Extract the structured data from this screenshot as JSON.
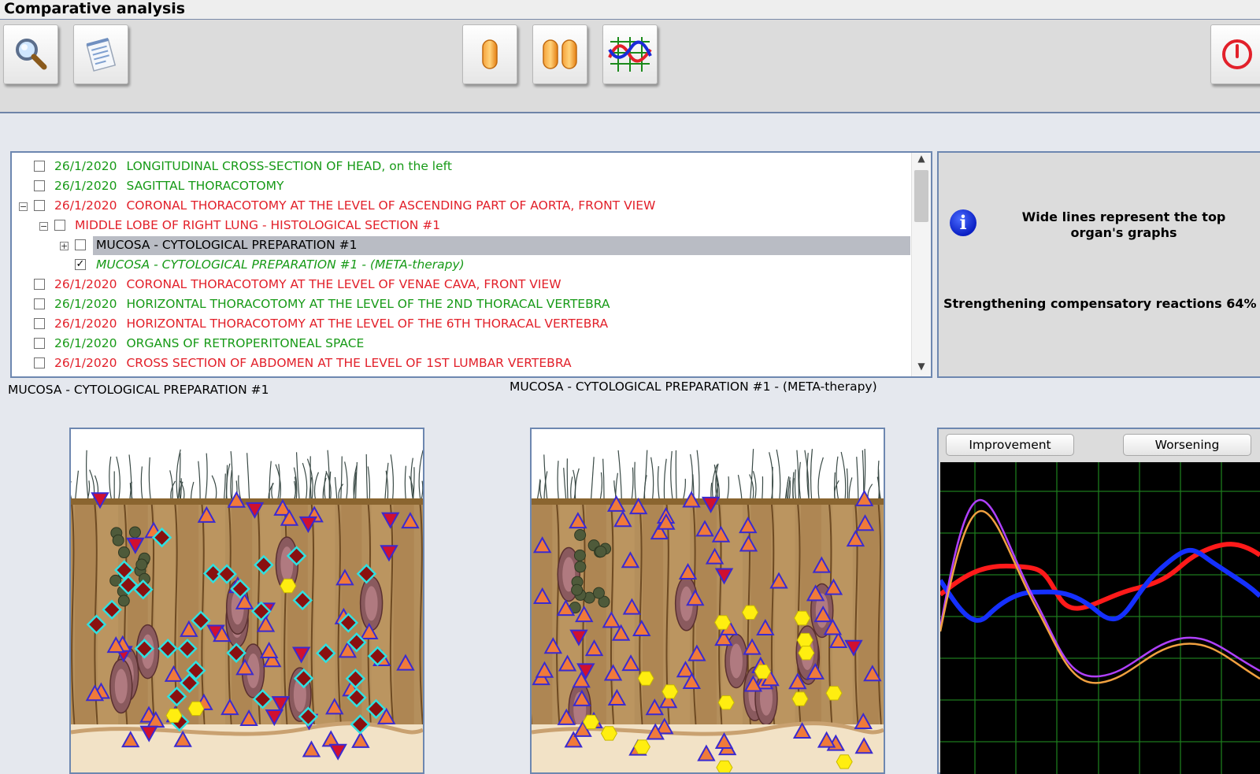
{
  "window": {
    "title": "Comparative analysis"
  },
  "toolbar": {
    "buttons": [
      {
        "name": "search-button",
        "icon": "magnifier-icon"
      },
      {
        "name": "notes-button",
        "icon": "notepad-icon"
      },
      {
        "name": "single-view-button",
        "icon": "single-capsule-icon"
      },
      {
        "name": "double-view-button",
        "icon": "double-capsule-icon"
      },
      {
        "name": "graph-view-button",
        "icon": "graph-icon"
      },
      {
        "name": "power-button",
        "icon": "power-icon"
      }
    ]
  },
  "tree": {
    "rows": [
      {
        "date": "26/1/2020",
        "label": "LONGITUDINAL CROSS-SECTION OF HEAD, on the left",
        "color": "green",
        "checked": false
      },
      {
        "date": "26/1/2020",
        "label": "SAGITTAL THORACOTOMY",
        "color": "green",
        "checked": false
      },
      {
        "date": "26/1/2020",
        "label": "CORONAL THORACOTOMY AT THE LEVEL OF ASCENDING PART OF AORTA, FRONT VIEW",
        "color": "red",
        "checked": false,
        "expander": "−"
      },
      {
        "date": "",
        "label": "MIDDLE LOBE OF RIGHT LUNG - HISTOLOGICAL SECTION #1",
        "color": "red",
        "checked": false,
        "expander": "−"
      },
      {
        "date": "",
        "label": "MUCOSA - CYTOLOGICAL PREPARATION #1",
        "color": "black",
        "checked": false,
        "expander": "+",
        "selected": true
      },
      {
        "date": "",
        "label": "MUCOSA - CYTOLOGICAL PREPARATION #1 - (META-therapy)",
        "color": "green",
        "checked": true,
        "italic": true
      },
      {
        "date": "26/1/2020",
        "label": "CORONAL THORACOTOMY AT THE LEVEL OF VENAE CAVA, FRONT VIEW",
        "color": "red",
        "checked": false
      },
      {
        "date": "26/1/2020",
        "label": "HORIZONTAL THORACOTOMY AT THE LEVEL OF THE 2ND THORACAL VERTEBRA",
        "color": "green",
        "checked": false
      },
      {
        "date": "26/1/2020",
        "label": "HORIZONTAL THORACOTOMY AT THE LEVEL OF THE 6TH THORACAL VERTEBRA",
        "color": "red",
        "checked": false
      },
      {
        "date": "26/1/2020",
        "label": "ORGANS OF RETROPERITONEAL SPACE",
        "color": "green",
        "checked": false
      },
      {
        "date": "26/1/2020",
        "label": "CROSS SECTION OF ABDOMEN AT THE LEVEL OF 1ST LUMBAR VERTEBRA",
        "color": "red",
        "checked": false
      }
    ]
  },
  "info": {
    "icon": "info-icon",
    "icon_glyph": "i",
    "note": "Wide lines represent the top organ's graphs",
    "result": "Strengthening compensatory reactions 64%"
  },
  "captions": {
    "left": "MUCOSA - CYTOLOGICAL PREPARATION #1",
    "right": "MUCOSA - CYTOLOGICAL PREPARATION #1 - (META-therapy)"
  },
  "chart": {
    "improvement_label": "Improvement",
    "worsening_label": "Worsening"
  },
  "colors": {
    "green": "#179a17",
    "red": "#e2202a",
    "frame": "#6d87b0"
  }
}
